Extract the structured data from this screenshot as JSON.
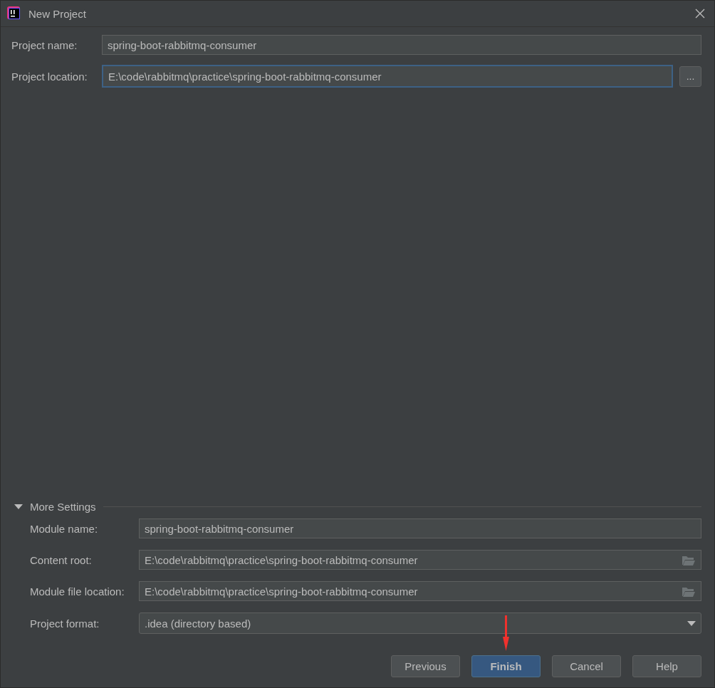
{
  "window": {
    "title": "New Project"
  },
  "project_fields": [
    {
      "kind": "text",
      "label": "Project name:",
      "value": "spring-boot-rabbitmq-consumer",
      "focused": false
    },
    {
      "kind": "browse",
      "label": "Project location:",
      "value": "E:\\code\\rabbitmq\\practice\\spring-boot-rabbitmq-consumer",
      "focused": true,
      "button": "..."
    }
  ],
  "more_settings": {
    "label": "More Settings",
    "expanded": true,
    "fields": [
      {
        "kind": "text",
        "label": "Module name:",
        "value": "spring-boot-rabbitmq-consumer"
      },
      {
        "kind": "folder",
        "label": "Content root:",
        "value": "E:\\code\\rabbitmq\\practice\\spring-boot-rabbitmq-consumer"
      },
      {
        "kind": "folder",
        "label": "Module file location:",
        "value": "E:\\code\\rabbitmq\\practice\\spring-boot-rabbitmq-consumer"
      },
      {
        "kind": "dropdown",
        "label": "Project format:",
        "value": ".idea (directory based)"
      }
    ]
  },
  "buttons": [
    {
      "label": "Previous",
      "primary": false
    },
    {
      "label": "Finish",
      "primary": true
    },
    {
      "label": "Cancel",
      "primary": false
    },
    {
      "label": "Help",
      "primary": false
    }
  ]
}
